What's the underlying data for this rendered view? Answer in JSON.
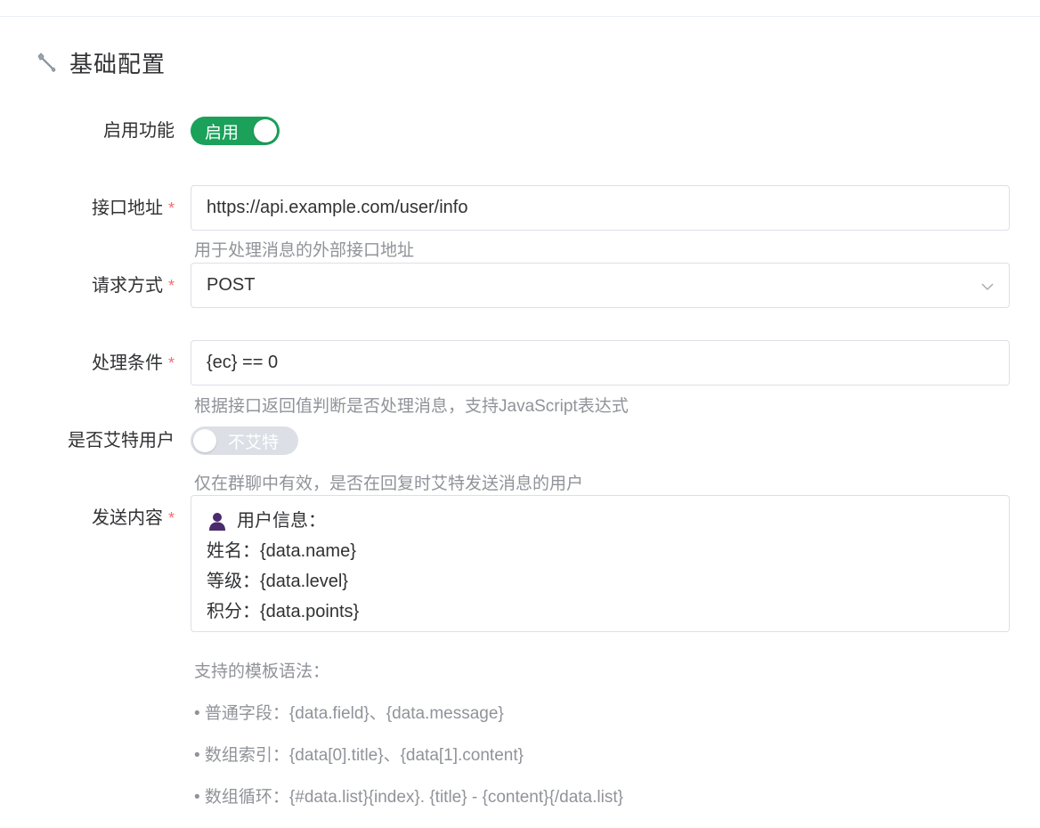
{
  "section": {
    "title": "基础配置",
    "icon": "wrench-icon"
  },
  "fields": {
    "enable": {
      "label": "启用功能",
      "switch_text": "启用",
      "value": true
    },
    "endpoint": {
      "label": "接口地址",
      "required_mark": "*",
      "value": "https://api.example.com/user/info",
      "hint": "用于处理消息的外部接口地址"
    },
    "method": {
      "label": "请求方式",
      "required_mark": "*",
      "value": "POST"
    },
    "condition": {
      "label": "处理条件",
      "required_mark": "*",
      "value": "{ec} == 0",
      "hint": "根据接口返回值判断是否处理消息，支持JavaScript表达式"
    },
    "mention": {
      "label": "是否艾特用户",
      "switch_text": "不艾特",
      "value": false,
      "hint": "仅在群聊中有效，是否在回复时艾特发送消息的用户"
    },
    "content": {
      "label": "发送内容",
      "required_mark": "*",
      "lines": [
        "用户信息：",
        "姓名：{data.name}",
        "等级：{data.level}",
        "积分：{data.points}"
      ]
    }
  },
  "syntax": {
    "title": "支持的模板语法：",
    "items": [
      "• 普通字段：{data.field}、{data.message}",
      "• 数组索引：{data[0].title}、{data[1].content}",
      "• 数组循环：{#data.list}{index}. {title} - {content}{/data.list}"
    ]
  },
  "colors": {
    "switch_on": "#1ba15a",
    "switch_off": "#dcdfe6",
    "required": "#f56c6c",
    "hint": "#909399"
  }
}
